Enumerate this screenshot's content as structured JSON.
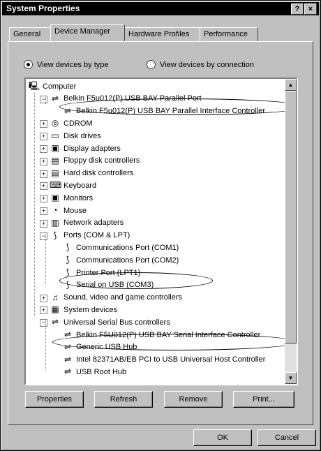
{
  "window": {
    "title": "System Properties",
    "help_label": "?",
    "close_label": "×"
  },
  "tabs": [
    {
      "label": "General"
    },
    {
      "label": "Device Manager"
    },
    {
      "label": "Hardware Profiles"
    },
    {
      "label": "Performance"
    }
  ],
  "view_options": {
    "by_type": "View devices by type",
    "by_connection": "View devices by connection",
    "selected": "by_type"
  },
  "tree": [
    {
      "label": "Computer",
      "icon": "computer-icon"
    },
    {
      "label": "Belkin F5u012(P) USB BAY Parallel Port",
      "icon": "usb-icon"
    },
    {
      "label": "Belkin F5u012(P) USB BAY Parallel Interface Controller",
      "icon": "usb-icon"
    },
    {
      "label": "CDROM",
      "icon": "cdrom-icon"
    },
    {
      "label": "Disk drives",
      "icon": "disk-icon"
    },
    {
      "label": "Display adapters",
      "icon": "monitor-icon"
    },
    {
      "label": "Floppy disk controllers",
      "icon": "controller-icon"
    },
    {
      "label": "Hard disk controllers",
      "icon": "controller-icon"
    },
    {
      "label": "Keyboard",
      "icon": "keyboard-icon"
    },
    {
      "label": "Monitors",
      "icon": "monitor-icon"
    },
    {
      "label": "Mouse",
      "icon": "mouse-icon"
    },
    {
      "label": "Network adapters",
      "icon": "network-icon"
    },
    {
      "label": "Ports (COM & LPT)",
      "icon": "port-icon"
    },
    {
      "label": "Communications Port (COM1)",
      "icon": "port-icon"
    },
    {
      "label": "Communications Port (COM2)",
      "icon": "port-icon"
    },
    {
      "label": "Printer Port (LPT1)",
      "icon": "port-icon"
    },
    {
      "label": "Serial on USB (COM3)",
      "icon": "port-icon"
    },
    {
      "label": "Sound, video and game controllers",
      "icon": "sound-icon"
    },
    {
      "label": "System devices",
      "icon": "system-icon"
    },
    {
      "label": "Universal Serial Bus controllers",
      "icon": "usb-icon"
    },
    {
      "label": "Belkin F5U012(P) USB BAY Serial Interface Controller",
      "icon": "usb-icon"
    },
    {
      "label": "Generic USB Hub",
      "icon": "usb-icon"
    },
    {
      "label": "Intel 82371AB/EB PCI to USB Universal Host Controller",
      "icon": "usb-icon"
    },
    {
      "label": "USB Root Hub",
      "icon": "usb-icon"
    }
  ],
  "buttons": {
    "properties": "Properties",
    "refresh": "Refresh",
    "remove": "Remove",
    "print": "Print...",
    "ok": "OK",
    "cancel": "Cancel"
  }
}
